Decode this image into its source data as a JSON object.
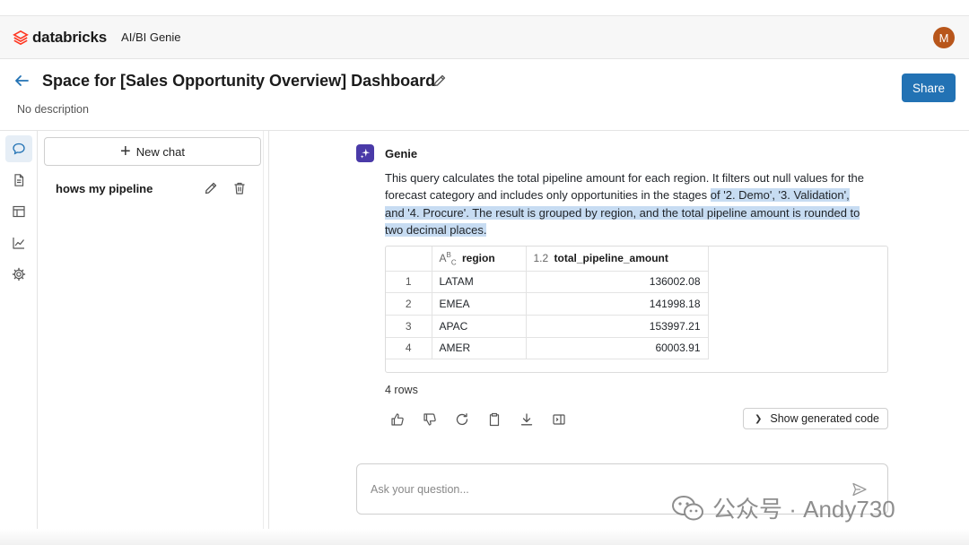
{
  "app": {
    "brand": "databricks",
    "product": "AI/BI Genie",
    "avatar_initial": "M",
    "brand_color": "#ff3621",
    "accent_color": "#2272b4"
  },
  "header": {
    "title": "Space for [Sales Opportunity Overview] Dashboard",
    "description": "No description",
    "share_label": "Share"
  },
  "rail": {
    "items": [
      {
        "icon": "chat-icon",
        "active": true
      },
      {
        "icon": "document-icon",
        "active": false
      },
      {
        "icon": "table-icon",
        "active": false
      },
      {
        "icon": "chart-icon",
        "active": false
      },
      {
        "icon": "gear-icon",
        "active": false
      }
    ]
  },
  "chats": {
    "new_chat_label": "New chat",
    "items": [
      {
        "label": "hows my pipeline"
      }
    ]
  },
  "message": {
    "author": "Genie",
    "text_plain": "This query calculates the total pipeline amount for each region. It filters out null values for the forecast category and includes only opportunities in the stages ",
    "text_highlight_1": "of '2. Demo', '3. Validation',",
    "text_highlight_2": "and '4. Procure'. The result is grouped by region, and the total pipeline amount is rounded to",
    "text_highlight_3": "two decimal places.",
    "table": {
      "columns": [
        {
          "type_tag": "",
          "label": ""
        },
        {
          "type_tag": "ABC",
          "label": "region"
        },
        {
          "type_tag": "1.2",
          "label": "total_pipeline_amount"
        }
      ],
      "rows": [
        {
          "index": "1",
          "region": "LATAM",
          "amount": "136002.08"
        },
        {
          "index": "2",
          "region": "EMEA",
          "amount": "141998.18"
        },
        {
          "index": "3",
          "region": "APAC",
          "amount": "153997.21"
        },
        {
          "index": "4",
          "region": "AMER",
          "amount": "60003.91"
        }
      ]
    },
    "row_count": "4 rows",
    "actions": [
      "thumbs-up-icon",
      "thumbs-down-icon",
      "refresh-icon",
      "clipboard-icon",
      "download-icon",
      "open-panel-icon"
    ],
    "show_code_label": "Show generated code"
  },
  "composer": {
    "placeholder": "Ask your question..."
  },
  "watermark": {
    "text": "公众号 · Andy730"
  }
}
